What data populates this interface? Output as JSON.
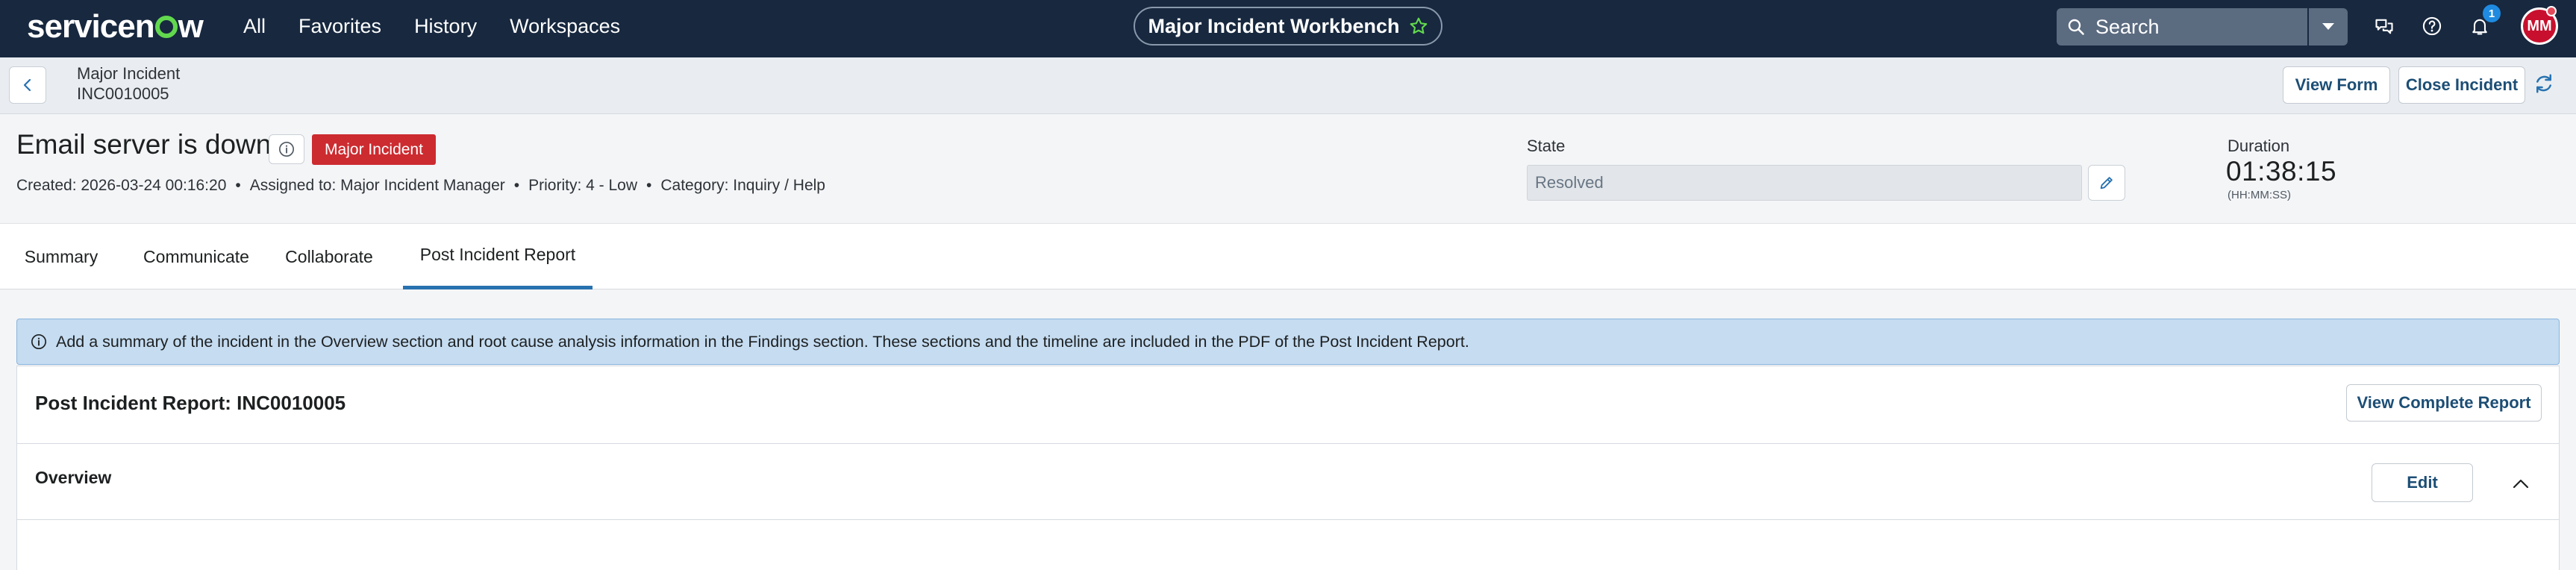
{
  "topnav": {
    "logo": "servicenow",
    "links": [
      "All",
      "Favorites",
      "History",
      "Workspaces"
    ],
    "workbench_title": "Major Incident Workbench",
    "search_placeholder": "Search",
    "notification_count": "1",
    "avatar_initials": "MM",
    "colors": {
      "bg": "#17283f",
      "logo_accent": "#62d84e",
      "star": "#62d84e"
    }
  },
  "subheader": {
    "record_type": "Major Incident",
    "record_number": "INC0010005",
    "view_form_label": "View Form",
    "close_incident_label": "Close Incident"
  },
  "incident": {
    "title": "Email server is down",
    "badge": "Major Incident",
    "meta": {
      "created": "Created: 2026-03-24 00:16:20",
      "assigned": "Assigned to: Major Incident Manager",
      "priority": "Priority: 4 - Low",
      "category": "Category: Inquiry / Help",
      "separator": "•"
    },
    "state_label": "State",
    "state_value": "Resolved",
    "duration_label": "Duration",
    "duration_value": "01:38:15",
    "duration_unit": "(HH:MM:SS)",
    "colors": {
      "badge": "#cc2b30"
    }
  },
  "tabs": [
    {
      "label": "Summary",
      "active": false
    },
    {
      "label": "Communicate",
      "active": false
    },
    {
      "label": "Collaborate",
      "active": false
    },
    {
      "label": "Post Incident Report",
      "active": true
    }
  ],
  "content": {
    "banner_text": "Add a summary of the incident in the Overview section and root cause analysis information in the Findings section. These sections and the timeline are included in the PDF of the Post Incident Report.",
    "report_title": "Post Incident Report: INC0010005",
    "view_complete_report_label": "View Complete Report",
    "overview_title": "Overview",
    "edit_label": "Edit",
    "colors": {
      "banner_bg": "#c5dcf1",
      "active_tab": "#2872b0"
    }
  }
}
